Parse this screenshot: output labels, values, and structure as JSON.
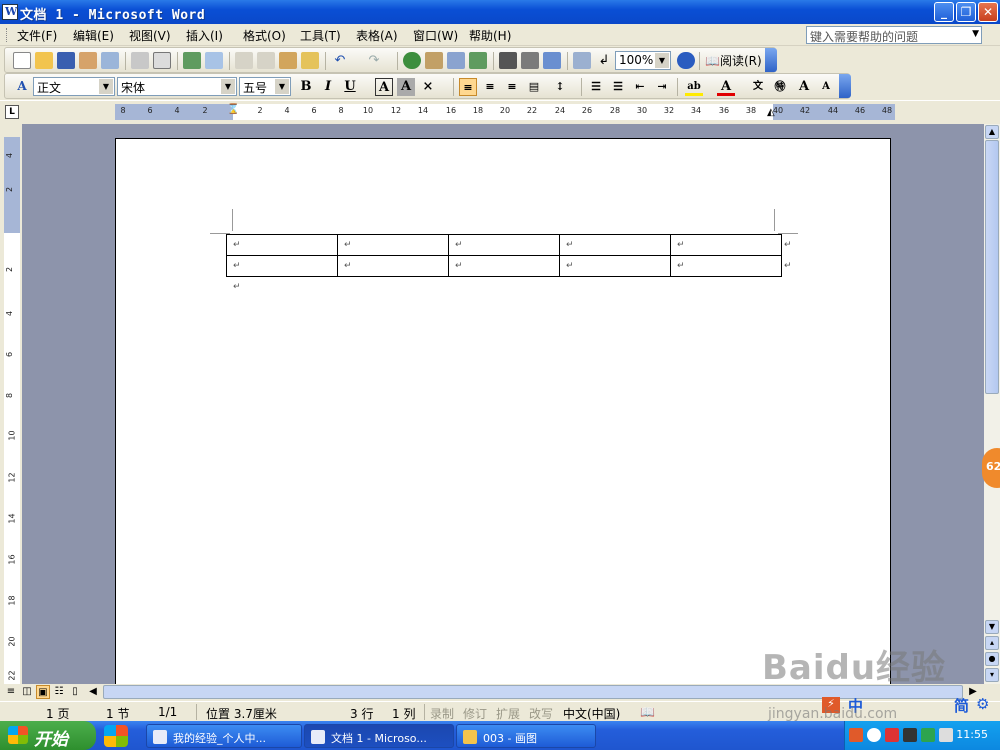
{
  "window": {
    "title": "文档 1 - Microsoft Word"
  },
  "menu": {
    "items": [
      "文件(F)",
      "编辑(E)",
      "视图(V)",
      "插入(I)",
      "格式(O)",
      "工具(T)",
      "表格(A)",
      "窗口(W)",
      "帮助(H)"
    ],
    "help_placeholder": "键入需要帮助的问题"
  },
  "standard_toolbar": {
    "zoom": "100%",
    "read_label": "阅读(R)"
  },
  "format_toolbar": {
    "style": "正文",
    "font": "宋体",
    "size": "五号"
  },
  "ruler": {
    "h_ticks": [
      "8",
      "6",
      "4",
      "2",
      "2",
      "4",
      "6",
      "8",
      "10",
      "12",
      "14",
      "16",
      "18",
      "20",
      "22",
      "24",
      "26",
      "28",
      "30",
      "32",
      "34",
      "36",
      "38",
      "40",
      "42",
      "44",
      "46",
      "48"
    ],
    "v_ticks": [
      "4",
      "2",
      "2",
      "4",
      "6",
      "8",
      "10",
      "12",
      "14",
      "16",
      "18",
      "20",
      "22"
    ]
  },
  "document": {
    "table": {
      "rows": 2,
      "cols": 5,
      "cell_mark": "↵"
    },
    "paragraph_mark": "↵"
  },
  "status": {
    "page": "1 页",
    "section": "1 节",
    "pages": "1/1",
    "position": "位置 3.7厘米",
    "line": "3 行",
    "col": "1 列",
    "rec": "录制",
    "trk": "修订",
    "ext": "扩展",
    "ovr": "改写",
    "lang": "中文(中国)"
  },
  "taskbar": {
    "start": "开始",
    "tasks": [
      {
        "label": "我的经验_个人中..."
      },
      {
        "label": "文档 1 - Microso..."
      },
      {
        "label": "003 - 画图"
      }
    ],
    "clock": "11:55"
  },
  "side_badge": "62",
  "ime": {
    "items": [
      "中",
      "简"
    ]
  },
  "watermark": {
    "brand": "Baidu经验",
    "url": "jingyan.baidu.com"
  }
}
